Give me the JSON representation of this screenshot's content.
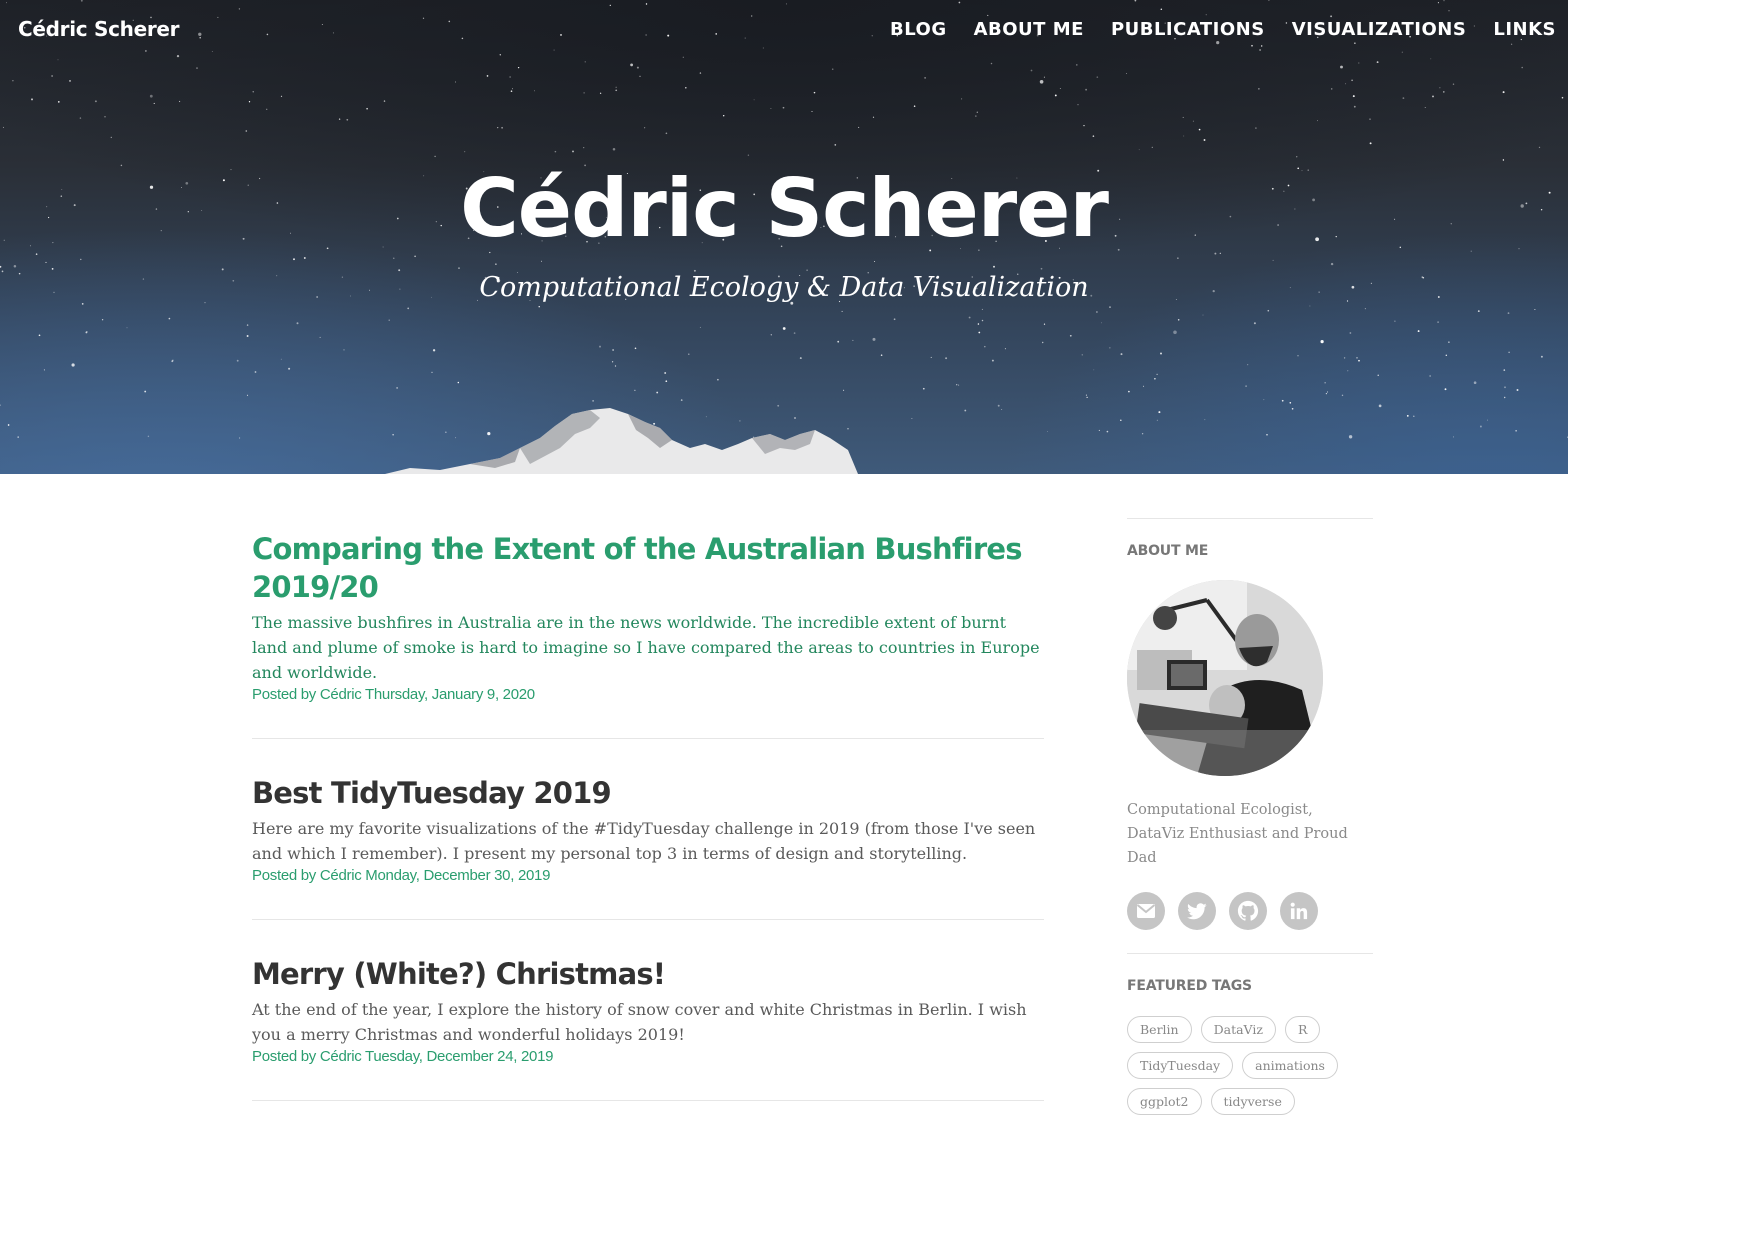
{
  "header": {
    "brand": "Cédric Scherer",
    "nav": [
      "BLOG",
      "ABOUT ME",
      "PUBLICATIONS",
      "VISUALIZATIONS",
      "LINKS"
    ],
    "title": "Cédric Scherer",
    "subtitle": "Computational Ecology & Data Visualization"
  },
  "posts": [
    {
      "title": "Comparing the Extent of the Australian Bushfires 2019/20",
      "summary": "The massive bushfires in Australia are in the news worldwide. The incredible extent of burnt land and plume of smoke is hard to imagine so I have compared the areas to countries in Europe and worldwide.",
      "meta": "Posted by Cédric Thursday, January 9, 2020",
      "highlighted": true
    },
    {
      "title": "Best TidyTuesday 2019",
      "summary": "Here are my favorite visualizations of the #TidyTuesday challenge in 2019 (from those I've seen and which I remember). I present my personal top 3 in terms of design and storytelling.",
      "meta": "Posted by Cédric Monday, December 30, 2019",
      "highlighted": false
    },
    {
      "title": "Merry (White?) Christmas!",
      "summary": "At the end of the year, I explore the history of snow cover and white Christmas in Berlin. I wish you a merry Christmas and wonderful holidays 2019!",
      "meta": "Posted by Cédric Tuesday, December 24, 2019",
      "highlighted": false
    }
  ],
  "sidebar": {
    "about_heading": "ABOUT ME",
    "bio": "Computational Ecologist, DataViz Enthusiast and Proud Dad",
    "social_icons": [
      "envelope-icon",
      "twitter-icon",
      "github-icon",
      "linkedin-icon"
    ],
    "tags_heading": "FEATURED TAGS",
    "tags": [
      "Berlin",
      "DataViz",
      "R",
      "TidyTuesday",
      "animations",
      "ggplot2",
      "tidyverse"
    ]
  },
  "colors": {
    "accent": "#2a9d6e",
    "text": "#333333",
    "muted": "#8a8a8a",
    "social_bg": "#c5c5c5"
  }
}
